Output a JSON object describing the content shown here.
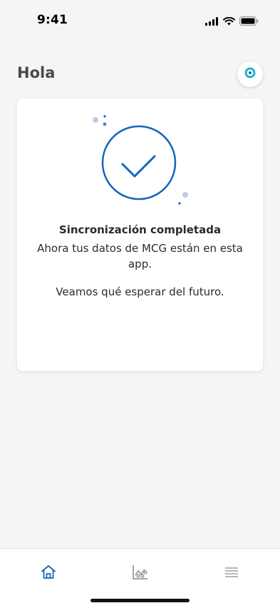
{
  "status_bar": {
    "time": "9:41"
  },
  "header": {
    "title": "Hola"
  },
  "card": {
    "title": "Sincronización completada",
    "description": "Ahora tus datos de MCG están en esta app.",
    "future": "Veamos qué esperar del futuro."
  },
  "nav": {
    "items": [
      {
        "icon": "home-icon",
        "active": true
      },
      {
        "icon": "chart-icon",
        "active": false
      },
      {
        "icon": "menu-icon",
        "active": false
      }
    ]
  },
  "colors": {
    "accent": "#1565c0",
    "profile_ring": "#1fb5c7",
    "inactive_icon": "#8a8a8a",
    "background": "#f5f5f5"
  }
}
